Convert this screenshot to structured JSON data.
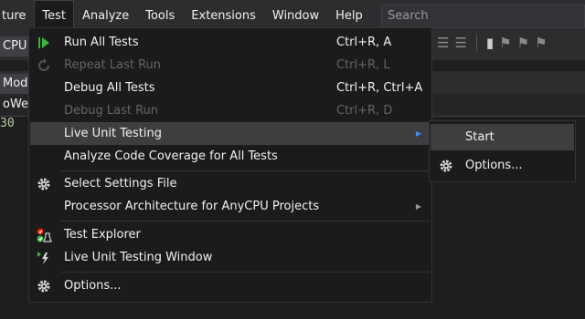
{
  "menubar": {
    "items": [
      "ture",
      "Test",
      "Analyze",
      "Tools",
      "Extensions",
      "Window",
      "Help"
    ],
    "search_placeholder": "Search"
  },
  "background": {
    "left_cpu": "CPU",
    "left_model": "Model",
    "left_web": "oWeb",
    "left_code": "30"
  },
  "test_menu": [
    {
      "label": "Run All Tests",
      "shortcut": "Ctrl+R, A",
      "icon": "run-all-icon",
      "enabled": true
    },
    {
      "label": "Repeat Last Run",
      "shortcut": "Ctrl+R, L",
      "icon": "repeat-icon",
      "enabled": false
    },
    {
      "label": "Debug All Tests",
      "shortcut": "Ctrl+R, Ctrl+A",
      "enabled": true
    },
    {
      "label": "Debug Last Run",
      "shortcut": "Ctrl+R, D",
      "enabled": false
    },
    {
      "label": "Live Unit Testing",
      "submenu": true,
      "highlighted": true,
      "enabled": true
    },
    {
      "label": "Analyze Code Coverage for All Tests",
      "enabled": true
    },
    {
      "label": "Select Settings File",
      "icon": "gear-icon",
      "enabled": true
    },
    {
      "label": "Processor Architecture for AnyCPU Projects",
      "submenu": true,
      "enabled": true
    },
    {
      "label": "Test Explorer",
      "icon": "test-explorer-icon",
      "enabled": true
    },
    {
      "label": "Live Unit Testing Window",
      "icon": "live-unit-testing-icon",
      "enabled": true
    },
    {
      "label": "Options...",
      "icon": "gear-icon",
      "enabled": true
    }
  ],
  "live_unit_testing_submenu": [
    {
      "label": "Start",
      "highlighted": true
    },
    {
      "label": "Options...",
      "icon": "gear-icon"
    }
  ],
  "colors": {
    "menu_bg": "#1b1b1c",
    "highlight": "#3e3e40",
    "accent_green": "#3eb33e",
    "submenu_arrow": "#3e8fe8"
  }
}
